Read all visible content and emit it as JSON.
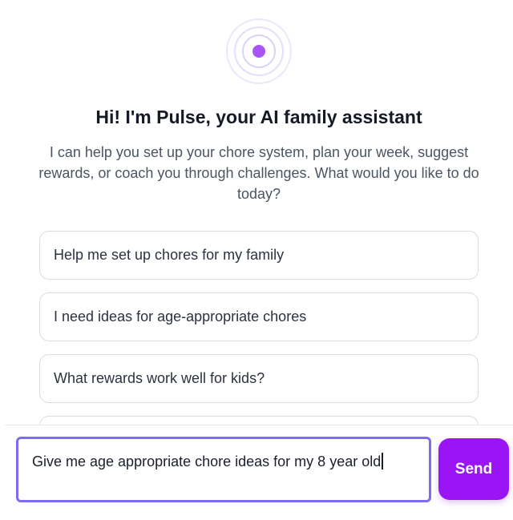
{
  "assistant": {
    "logo_icon": "pulse-rings-icon",
    "accent_color": "#a855f7",
    "title": "Hi! I'm Pulse, your AI family assistant",
    "subtitle": "I can help you set up your chore system, plan your week, suggest rewards, or coach you through challenges. What would you like to do today?"
  },
  "suggestions": [
    {
      "label": "Help me set up chores for my family"
    },
    {
      "label": "I need ideas for age-appropriate chores"
    },
    {
      "label": "What rewards work well for kids?"
    },
    {
      "label": ""
    }
  ],
  "composer": {
    "value": "Give me age appropriate chore ideas for my 8 year old",
    "send_label": "Send",
    "send_color": "#9b14f5",
    "border_color": "#7b6cf0"
  }
}
